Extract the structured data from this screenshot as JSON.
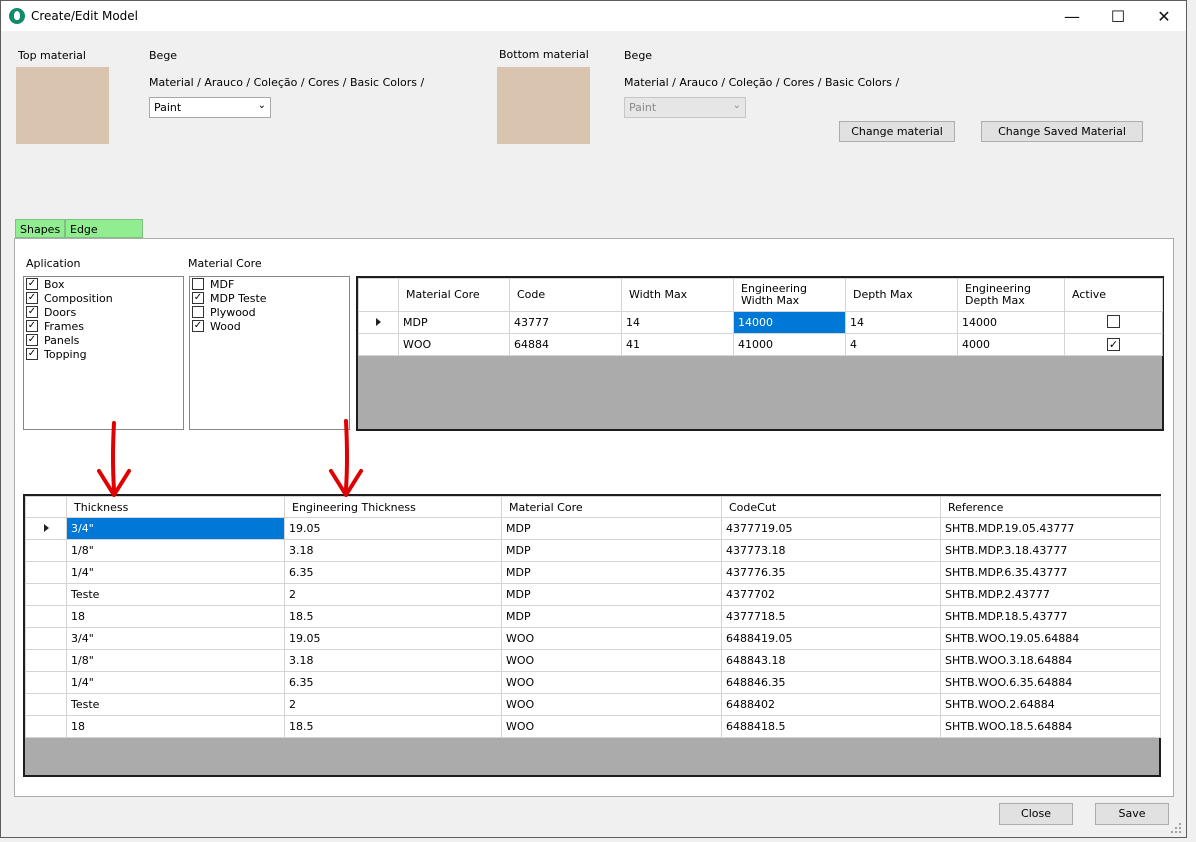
{
  "window": {
    "title": "Create/Edit Model",
    "controls": {
      "minimize": "—",
      "maximize": "☐",
      "close": "✕"
    }
  },
  "top_material": {
    "label": "Top material",
    "name": "Bege",
    "path": "Material / Arauco / Coleção / Cores / Basic Colors /",
    "finish": "Paint",
    "swatch_color": "#d8c4af"
  },
  "bottom_material": {
    "label": "Bottom material",
    "name": "Bege",
    "path": "Material / Arauco / Coleção / Cores / Basic Colors /",
    "finish": "Paint",
    "swatch_color": "#d8c4af"
  },
  "buttons": {
    "change_material": "Change material",
    "change_saved_material": "Change Saved Material",
    "close": "Close",
    "save": "Save"
  },
  "tabs": [
    {
      "label": "Shapes",
      "selected": true
    },
    {
      "label": "Edge Banding",
      "selected": false
    }
  ],
  "aplication": {
    "label": "Aplication",
    "items": [
      {
        "label": "Box",
        "checked": true
      },
      {
        "label": "Composition",
        "checked": true
      },
      {
        "label": "Doors",
        "checked": true
      },
      {
        "label": "Frames",
        "checked": true
      },
      {
        "label": "Panels",
        "checked": true
      },
      {
        "label": "Topping",
        "checked": true
      }
    ]
  },
  "material_core": {
    "label": "Material Core",
    "items": [
      {
        "label": "MDF",
        "checked": false
      },
      {
        "label": "MDP Teste",
        "checked": true
      },
      {
        "label": "Plywood",
        "checked": false
      },
      {
        "label": "Wood",
        "checked": true
      }
    ]
  },
  "core_grid": {
    "columns": [
      "Material Core",
      "Code",
      "Width Max",
      "Engineering\nWidth Max",
      "Depth Max",
      "Engineering\nDepth Max",
      "Active"
    ],
    "rows": [
      {
        "material_core": "MDP",
        "code": "43777",
        "width_max": "14",
        "eng_width_max": "14000",
        "depth_max": "14",
        "eng_depth_max": "14000",
        "active": false
      },
      {
        "material_core": "WOO",
        "code": "64884",
        "width_max": "41",
        "eng_width_max": "41000",
        "depth_max": "4",
        "eng_depth_max": "4000",
        "active": true
      }
    ]
  },
  "thickness_grid": {
    "columns": [
      "Thickness",
      "Engineering Thickness",
      "Material Core",
      "CodeCut",
      "Reference"
    ],
    "rows": [
      [
        "3/4\"",
        "19.05",
        "MDP",
        "4377719.05",
        "SHTB.MDP.19.05.43777"
      ],
      [
        "1/8\"",
        "3.18",
        "MDP",
        "437773.18",
        "SHTB.MDP.3.18.43777"
      ],
      [
        "1/4\"",
        "6.35",
        "MDP",
        "437776.35",
        "SHTB.MDP.6.35.43777"
      ],
      [
        "Teste",
        "2",
        "MDP",
        "4377702",
        "SHTB.MDP.2.43777"
      ],
      [
        "18",
        "18.5",
        "MDP",
        "4377718.5",
        "SHTB.MDP.18.5.43777"
      ],
      [
        "3/4\"",
        "19.05",
        "WOO",
        "6488419.05",
        "SHTB.WOO.19.05.64884"
      ],
      [
        "1/8\"",
        "3.18",
        "WOO",
        "648843.18",
        "SHTB.WOO.3.18.64884"
      ],
      [
        "1/4\"",
        "6.35",
        "WOO",
        "648846.35",
        "SHTB.WOO.6.35.64884"
      ],
      [
        "Teste",
        "2",
        "WOO",
        "6488402",
        "SHTB.WOO.2.64884"
      ],
      [
        "18",
        "18.5",
        "WOO",
        "6488418.5",
        "SHTB.WOO.18.5.64884"
      ]
    ]
  },
  "colors": {
    "selection": "#0078d7",
    "tab_active": "#90ee90",
    "annotation_arrow": "#e00000"
  }
}
